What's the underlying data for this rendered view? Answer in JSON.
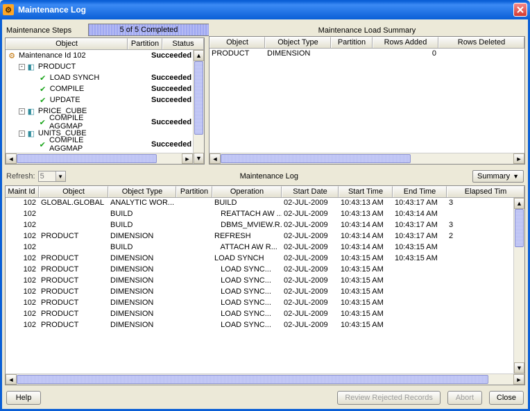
{
  "window": {
    "title": "Maintenance Log"
  },
  "steps": {
    "label": "Maintenance Steps",
    "progress": "5 of 5 Completed",
    "headers": {
      "object": "Object",
      "partition": "Partition",
      "status": "Status"
    },
    "tree": [
      {
        "depth": 0,
        "twisty": "",
        "icon": "maint",
        "label": "Maintenance Id 102",
        "status": "Succeeded"
      },
      {
        "depth": 1,
        "twisty": "-",
        "icon": "cube",
        "label": "PRODUCT",
        "status": ""
      },
      {
        "depth": 2,
        "twisty": "",
        "icon": "check",
        "label": "LOAD SYNCH",
        "status": "Succeeded"
      },
      {
        "depth": 2,
        "twisty": "",
        "icon": "check",
        "label": "COMPILE",
        "status": "Succeeded"
      },
      {
        "depth": 2,
        "twisty": "",
        "icon": "check",
        "label": "UPDATE",
        "status": "Succeeded"
      },
      {
        "depth": 1,
        "twisty": "-",
        "icon": "cube",
        "label": "PRICE_CUBE",
        "status": ""
      },
      {
        "depth": 2,
        "twisty": "",
        "icon": "check",
        "label": "COMPILE AGGMAP",
        "status": "Succeeded"
      },
      {
        "depth": 1,
        "twisty": "-",
        "icon": "cube",
        "label": "UNITS_CUBE",
        "status": ""
      },
      {
        "depth": 2,
        "twisty": "",
        "icon": "check",
        "label": "COMPILE AGGMAP",
        "status": "Succeeded"
      }
    ]
  },
  "summary": {
    "title": "Maintenance Load Summary",
    "headers": {
      "object": "Object",
      "otype": "Object Type",
      "partition": "Partition",
      "rows_added": "Rows Added",
      "rows_deleted": "Rows Deleted"
    },
    "rows": [
      {
        "object": "PRODUCT",
        "otype": "DIMENSION",
        "partition": "",
        "rows_added": "0",
        "rows_deleted": ""
      }
    ]
  },
  "mid": {
    "refresh_label": "Refresh:",
    "refresh_value": "5",
    "log_title": "Maintenance Log",
    "summary_dd": "Summary"
  },
  "log": {
    "headers": {
      "maint_id": "Maint Id",
      "object": "Object",
      "otype": "Object Type",
      "partition": "Partition",
      "operation": "Operation",
      "start_date": "Start Date",
      "start_time": "Start Time",
      "end_time": "End Time",
      "elapsed": "Elapsed Tim"
    },
    "rows": [
      {
        "id": "102",
        "object": "GLOBAL.GLOBAL",
        "otype": "ANALYTIC WOR...",
        "part": "",
        "op": "BUILD",
        "sdate": "02-JUL-2009",
        "stime": "10:43:13 AM",
        "etime": "10:43:17 AM",
        "el": "3"
      },
      {
        "id": "102",
        "object": "",
        "otype": "BUILD",
        "part": "",
        "op": "REATTACH AW ...",
        "sdate": "02-JUL-2009",
        "stime": "10:43:13 AM",
        "etime": "10:43:14 AM",
        "el": ""
      },
      {
        "id": "102",
        "object": "",
        "otype": "BUILD",
        "part": "",
        "op": "DBMS_MVIEW.R...",
        "sdate": "02-JUL-2009",
        "stime": "10:43:14 AM",
        "etime": "10:43:17 AM",
        "el": "3"
      },
      {
        "id": "102",
        "object": "PRODUCT",
        "otype": "DIMENSION",
        "part": "",
        "op": "REFRESH",
        "sdate": "02-JUL-2009",
        "stime": "10:43:14 AM",
        "etime": "10:43:17 AM",
        "el": "2"
      },
      {
        "id": "102",
        "object": "",
        "otype": "BUILD",
        "part": "",
        "op": "ATTACH AW R...",
        "sdate": "02-JUL-2009",
        "stime": "10:43:14 AM",
        "etime": "10:43:15 AM",
        "el": ""
      },
      {
        "id": "102",
        "object": "PRODUCT",
        "otype": "DIMENSION",
        "part": "",
        "op": "LOAD SYNCH",
        "sdate": "02-JUL-2009",
        "stime": "10:43:15 AM",
        "etime": "10:43:15 AM",
        "el": ""
      },
      {
        "id": "102",
        "object": "PRODUCT",
        "otype": "DIMENSION",
        "part": "",
        "op": "LOAD SYNC...",
        "sdate": "02-JUL-2009",
        "stime": "10:43:15 AM",
        "etime": "",
        "el": ""
      },
      {
        "id": "102",
        "object": "PRODUCT",
        "otype": "DIMENSION",
        "part": "",
        "op": "LOAD SYNC...",
        "sdate": "02-JUL-2009",
        "stime": "10:43:15 AM",
        "etime": "",
        "el": ""
      },
      {
        "id": "102",
        "object": "PRODUCT",
        "otype": "DIMENSION",
        "part": "",
        "op": "LOAD SYNC...",
        "sdate": "02-JUL-2009",
        "stime": "10:43:15 AM",
        "etime": "",
        "el": ""
      },
      {
        "id": "102",
        "object": "PRODUCT",
        "otype": "DIMENSION",
        "part": "",
        "op": "LOAD SYNC...",
        "sdate": "02-JUL-2009",
        "stime": "10:43:15 AM",
        "etime": "",
        "el": ""
      },
      {
        "id": "102",
        "object": "PRODUCT",
        "otype": "DIMENSION",
        "part": "",
        "op": "LOAD SYNC...",
        "sdate": "02-JUL-2009",
        "stime": "10:43:15 AM",
        "etime": "",
        "el": ""
      },
      {
        "id": "102",
        "object": "PRODUCT",
        "otype": "DIMENSION",
        "part": "",
        "op": "LOAD SYNC...",
        "sdate": "02-JUL-2009",
        "stime": "10:43:15 AM",
        "etime": "",
        "el": ""
      }
    ]
  },
  "footer": {
    "help": "Help",
    "review": "Review Rejected Records",
    "abort": "Abort",
    "close": "Close"
  }
}
